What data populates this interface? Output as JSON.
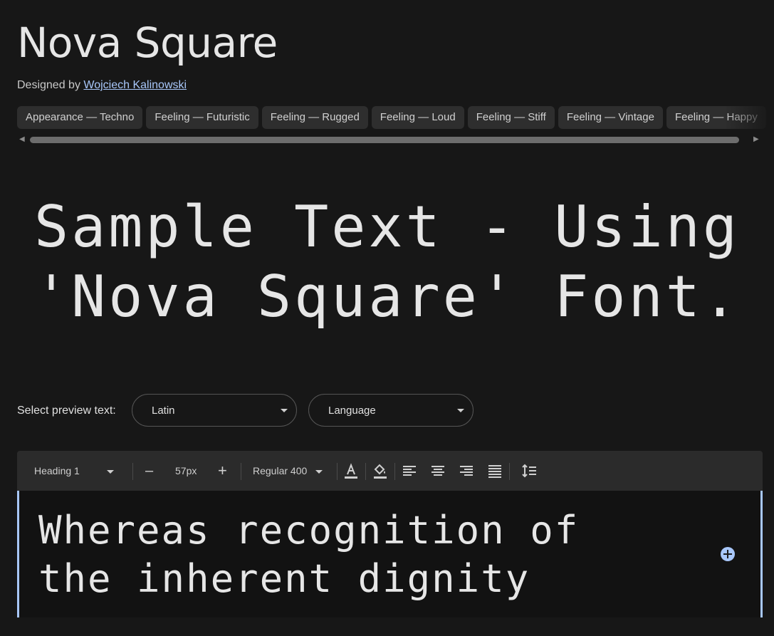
{
  "font": {
    "name": "Nova Square",
    "designer_prefix": "Designed by",
    "designer_name": "Wojciech Kalinowski"
  },
  "tags": [
    "Appearance — Techno",
    "Feeling — Futuristic",
    "Feeling — Rugged",
    "Feeling — Loud",
    "Feeling — Stiff",
    "Feeling — Vintage",
    "Feeling — Happy"
  ],
  "sample_text": "Sample Text - Using 'Nova Square' Font.",
  "preview": {
    "label": "Select preview text:",
    "script_value": "Latin",
    "language_value": "Language"
  },
  "toolbar": {
    "style_value": "Heading 1",
    "size_value": "57px",
    "decrease": "–",
    "increase": "+",
    "weight_value": "Regular 400"
  },
  "editor": {
    "text": "Whereas recognition of the inherent dignity"
  },
  "colors": {
    "background": "#171717",
    "accent": "#a8c7fa",
    "tag_bg": "#2e2e2e"
  }
}
